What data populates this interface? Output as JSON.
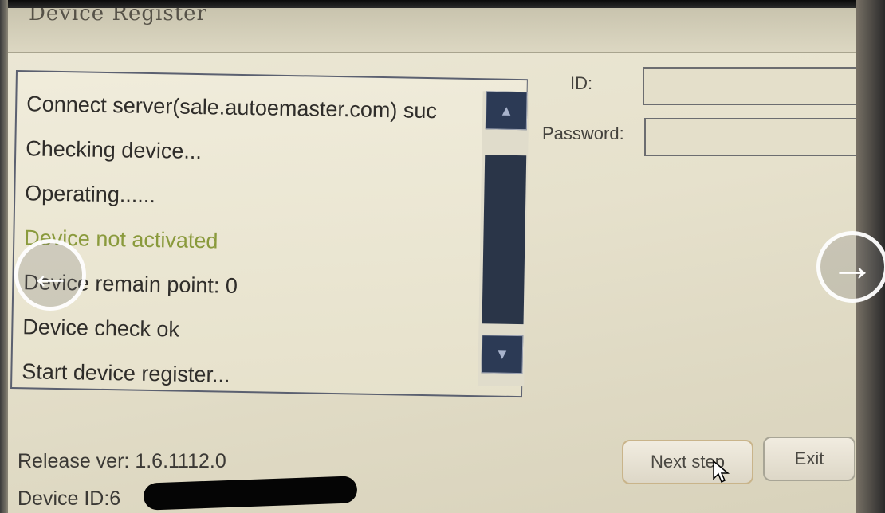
{
  "window": {
    "title": "Device Register"
  },
  "log": {
    "lines": [
      {
        "text": "Connect server(sale.autoemaster.com) suc",
        "status": "normal"
      },
      {
        "text": "Checking device...",
        "status": "normal"
      },
      {
        "text": "Operating......",
        "status": "normal"
      },
      {
        "text": "Device not activated",
        "status": "warning"
      },
      {
        "text": "Device remain point: 0",
        "status": "normal"
      },
      {
        "text": "Device check ok",
        "status": "normal"
      },
      {
        "text": "Start device register...",
        "status": "normal"
      }
    ],
    "scroll_up_icon": "chevron-up-icon",
    "scroll_down_icon": "chevron-down-icon"
  },
  "form": {
    "id_label": "ID:",
    "id_value": "",
    "password_label": "Password:",
    "password_value": ""
  },
  "footer": {
    "release_label": "Release ver:",
    "release_value": "1.6.1112.0",
    "device_id_label": "Device ID:6"
  },
  "buttons": {
    "next_label": "Next step",
    "exit_label": "Exit"
  },
  "overlay": {
    "prev_icon": "arrow-left-icon",
    "next_icon": "arrow-right-icon"
  },
  "colors": {
    "panel_bg": "#e6e1cc",
    "scrollbar": "#2c3a55",
    "warning_text": "#8a9a3c",
    "button_border": "#c9b48a"
  }
}
